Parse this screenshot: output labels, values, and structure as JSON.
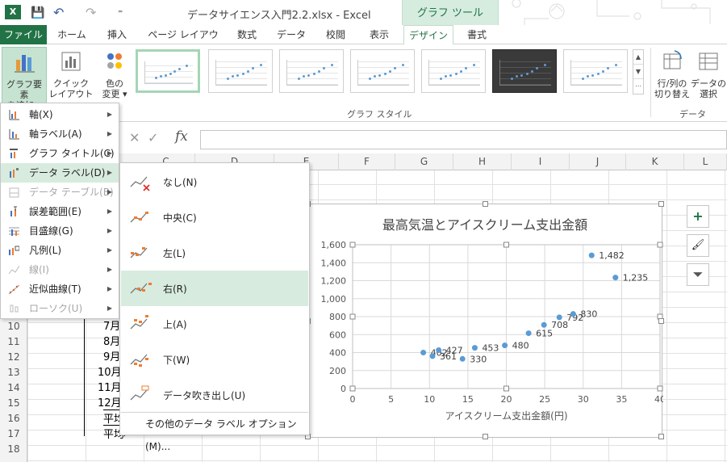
{
  "titlebar": {
    "doc_title": "データサイエンス入門2.2.xlsx - Excel",
    "tool_header": "グラフ ツール",
    "xl_icon": "X",
    "save_glyph": "💾",
    "undo_glyph": "↶",
    "redo_glyph": "↷",
    "qat_more": "⁼",
    "icons": [
      "excel-icon",
      "save-icon",
      "undo-icon",
      "redo-icon",
      "customize-qat-icon"
    ]
  },
  "tabs": [
    {
      "label": "ファイル"
    },
    {
      "label": "ホーム"
    },
    {
      "label": "挿入"
    },
    {
      "label": "ページ レイアウト"
    },
    {
      "label": "数式"
    },
    {
      "label": "データ"
    },
    {
      "label": "校閲"
    },
    {
      "label": "表示"
    },
    {
      "label": "デザイン"
    },
    {
      "label": "書式"
    }
  ],
  "ribbon": {
    "add_element": {
      "line1": "グラフ要素",
      "line2": "を追加 ▾"
    },
    "quick_layout": {
      "line1": "クイック",
      "line2": "レイアウト ▾"
    },
    "change_color": {
      "line1": "色の",
      "line2": "変更 ▾"
    },
    "style_group_label": "グラフ スタイル",
    "data_group_label": "データ",
    "switch_rowcol": {
      "line1": "行/列の",
      "line2": "切り替え"
    },
    "select_data": {
      "line1": "データの",
      "line2": "選択"
    },
    "gallery_scroll": [
      "▲",
      "▼",
      "⋯"
    ],
    "accent_color": "#217346"
  },
  "formulabar": {
    "cancel_glyph": "✕",
    "enter_glyph": "✓",
    "fx_label": "fx",
    "value": ""
  },
  "columns": [
    "C",
    "D",
    "E",
    "F",
    "G",
    "H",
    "I",
    "J",
    "K",
    "L"
  ],
  "rows": [
    "10",
    "11",
    "12",
    "13",
    "14",
    "15",
    "16",
    "17",
    "18"
  ],
  "cells": {
    "visible": [
      "7月",
      "8月",
      "9月",
      "10月",
      "11月",
      "12月",
      "平均",
      "平均"
    ]
  },
  "menu": {
    "items": [
      {
        "label": "軸(X)",
        "icon": "axis-icon",
        "disabled": false
      },
      {
        "label": "軸ラベル(A)",
        "icon": "axis-label-icon",
        "disabled": false
      },
      {
        "label": "グラフ タイトル(C)",
        "icon": "chart-title-icon",
        "disabled": false
      },
      {
        "label": "データ ラベル(D)",
        "icon": "data-label-icon",
        "disabled": false
      },
      {
        "label": "データ テーブル(B)",
        "icon": "data-table-icon",
        "disabled": true
      },
      {
        "label": "誤差範囲(E)",
        "icon": "error-bars-icon",
        "disabled": false
      },
      {
        "label": "目盛線(G)",
        "icon": "gridlines-icon",
        "disabled": false
      },
      {
        "label": "凡例(L)",
        "icon": "legend-icon",
        "disabled": false
      },
      {
        "label": "線(I)",
        "icon": "lines-icon",
        "disabled": true
      },
      {
        "label": "近似曲線(T)",
        "icon": "trendline-icon",
        "disabled": false
      },
      {
        "label": "ローソク(U)",
        "icon": "updown-bars-icon",
        "disabled": true
      }
    ],
    "arrow_glyph": "▶"
  },
  "submenu": {
    "items": [
      {
        "label": "なし(N)",
        "icon": "label-none-icon"
      },
      {
        "label": "中央(C)",
        "icon": "label-center-icon"
      },
      {
        "label": "左(L)",
        "icon": "label-left-icon"
      },
      {
        "label": "右(R)",
        "icon": "label-right-icon"
      },
      {
        "label": "上(A)",
        "icon": "label-above-icon"
      },
      {
        "label": "下(W)",
        "icon": "label-below-icon"
      },
      {
        "label": "データ吹き出し(U)",
        "icon": "label-callout-icon"
      }
    ],
    "more_options": "その他のデータ ラベル オプション(M)..."
  },
  "side_buttons": {
    "plus": "+",
    "brush": "🖌",
    "filter": "⏷"
  },
  "chart_data": {
    "type": "scatter",
    "title": "最高気温とアイスクリーム支出金額",
    "xlabel": "アイスクリーム支出金額(円)",
    "ylabel": "",
    "xlim": [
      0,
      40
    ],
    "ylim": [
      0,
      1600
    ],
    "x_ticks": [
      "0",
      "5",
      "10",
      "15",
      "20",
      "25",
      "30",
      "35",
      "40"
    ],
    "y_ticks": [
      "0",
      "200",
      "400",
      "600",
      "800",
      "1,000",
      "1,200",
      "1,400",
      "1,600"
    ],
    "grid": true,
    "marker_color": "#5b9bd5",
    "points": [
      {
        "x": 9.2,
        "y": 400,
        "label": "402"
      },
      {
        "x": 10.4,
        "y": 361,
        "label": "361"
      },
      {
        "x": 11.2,
        "y": 427,
        "label": "427"
      },
      {
        "x": 14.3,
        "y": 330,
        "label": "330"
      },
      {
        "x": 15.9,
        "y": 453,
        "label": "453"
      },
      {
        "x": 19.8,
        "y": 480,
        "label": "480"
      },
      {
        "x": 22.9,
        "y": 615,
        "label": "615"
      },
      {
        "x": 24.9,
        "y": 708,
        "label": "708"
      },
      {
        "x": 26.9,
        "y": 792,
        "label": "792"
      },
      {
        "x": 28.7,
        "y": 830,
        "label": "830"
      },
      {
        "x": 31.1,
        "y": 1482,
        "label": "1,482"
      },
      {
        "x": 34.2,
        "y": 1235,
        "label": "1,235"
      }
    ]
  }
}
